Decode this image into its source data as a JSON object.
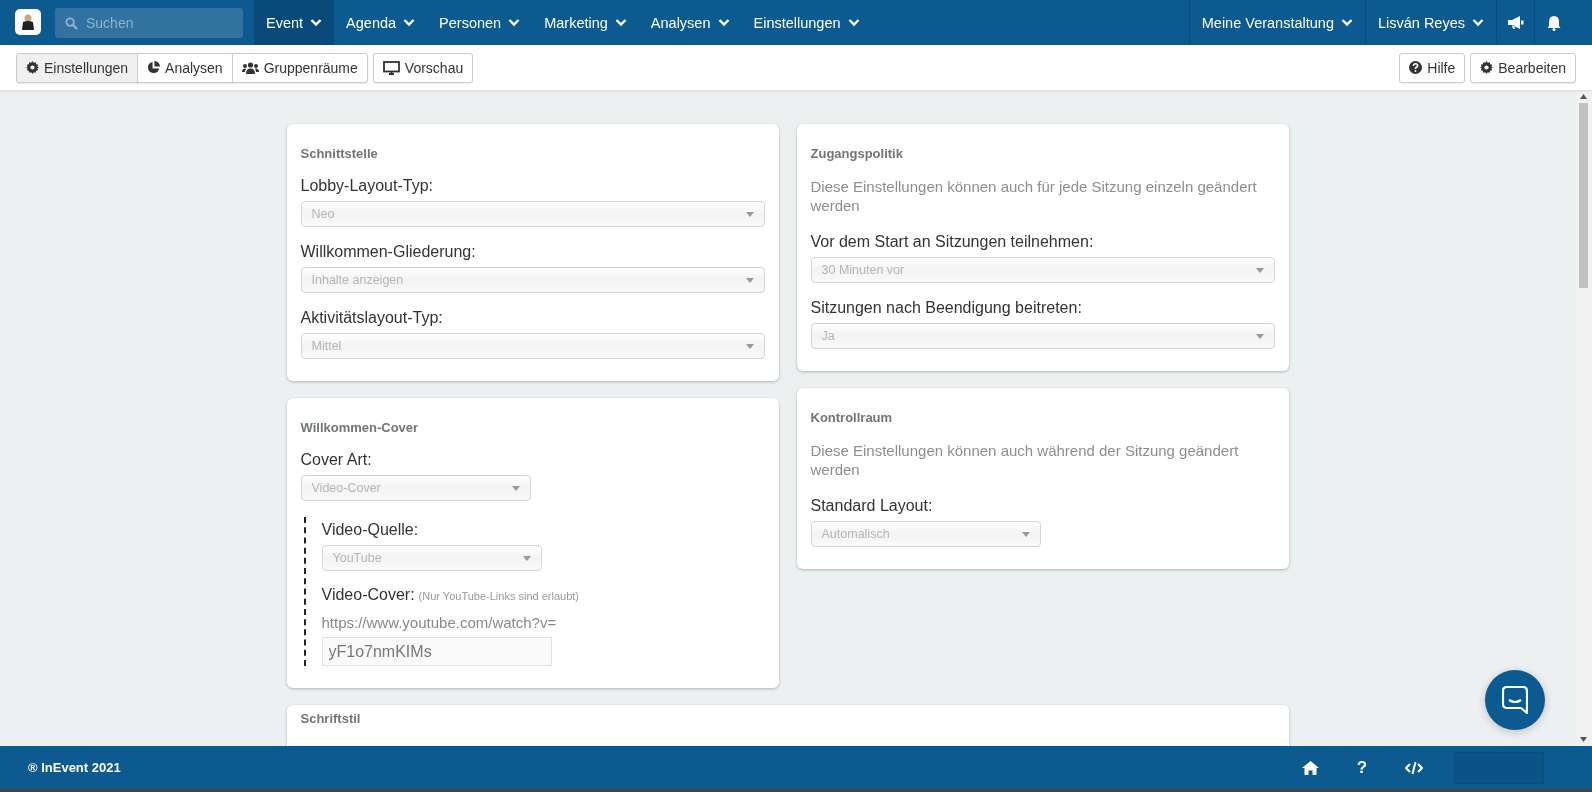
{
  "nav": {
    "search": {
      "placeholder": "Suchen"
    },
    "items": [
      {
        "label": "Event",
        "selected": true
      },
      {
        "label": "Agenda",
        "selected": false
      },
      {
        "label": "Personen",
        "selected": false
      },
      {
        "label": "Marketing",
        "selected": false
      },
      {
        "label": "Analysen",
        "selected": false
      },
      {
        "label": "Einstellungen",
        "selected": false
      }
    ],
    "right_items": [
      {
        "label": "Meine Veranstaltung"
      },
      {
        "label": "Lisván Reyes"
      }
    ]
  },
  "toolbar": {
    "tabs": [
      {
        "label": "Einstellungen",
        "selected": true
      },
      {
        "label": "Analysen",
        "selected": false
      },
      {
        "label": "Gruppenräume",
        "selected": false
      }
    ],
    "preview": {
      "label": "Vorschau"
    },
    "right_buttons": [
      {
        "label": "Hilfe"
      },
      {
        "label": "Bearbeiten"
      }
    ]
  },
  "columns": [
    {
      "cards": [
        {
          "title": "Schnittstelle",
          "fields": [
            {
              "kind": "select",
              "label": "Lobby-Layout-Typ:",
              "value": "Neo"
            },
            {
              "kind": "select",
              "label": "Willkommen-Gliederung:",
              "value": "Inhalte anzeigen"
            },
            {
              "kind": "select",
              "label": "Aktivitätslayout-Typ:",
              "value": "Mittel"
            }
          ]
        },
        {
          "title": "Willkommen-Cover",
          "fields": [
            {
              "kind": "short-select",
              "label": "Cover Art:",
              "value": "Video-Cover"
            },
            {
              "kind": "group",
              "children": [
                {
                  "kind": "short-select",
                  "label": "Video-Quelle:",
                  "value": "YouTube"
                },
                {
                  "kind": "url",
                  "label": "Video-Cover:",
                  "hint": "(Nur YouTube-Links sind erlaubt)",
                  "prefix": "https://www.youtube.com/watch?v=",
                  "value": "yF1o7nmKIMs"
                }
              ]
            }
          ]
        }
      ]
    },
    {
      "cards": [
        {
          "title": "Zugangspolitik",
          "description": "Diese Einstellungen können auch für jede Sitzung einzeln geändert werden",
          "fields": [
            {
              "kind": "select",
              "label": "Vor dem Start an Sitzungen teilnehmen:",
              "value": "30 Minuten vor"
            },
            {
              "kind": "select",
              "label": "Sitzungen nach Beendigung beitreten:",
              "value": "Ja"
            }
          ]
        },
        {
          "title": "Kontrollraum",
          "description": "Diese Einstellungen können auch während der Sitzung geändert werden",
          "fields": [
            {
              "kind": "short-select",
              "label": "Standard Layout:",
              "value": "Automalisch"
            }
          ]
        }
      ]
    }
  ],
  "wide_card": {
    "title": "Schriftstil"
  },
  "footer": {
    "copyright": "® InEvent 2021",
    "help": "?"
  }
}
